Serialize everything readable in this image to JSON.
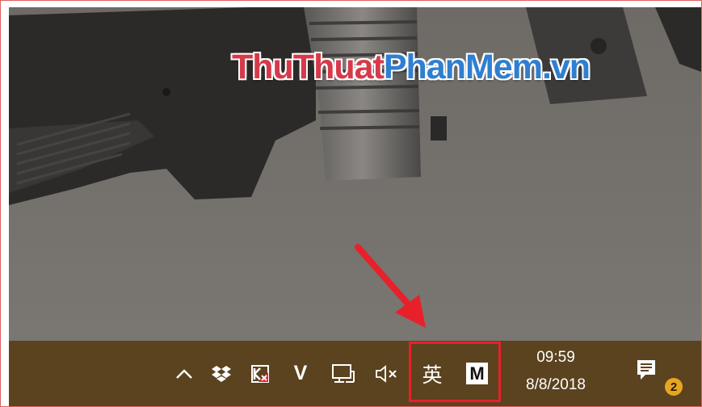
{
  "watermark": {
    "part1": "ThuThuat",
    "part2": "PhanMem.vn"
  },
  "taskbar": {
    "tray_icons": [
      {
        "name": "show-hidden-icons",
        "icon": "chevron-up-icon"
      },
      {
        "name": "dropbox",
        "icon": "dropbox-icon"
      },
      {
        "name": "kaspersky",
        "icon": "kaspersky-icon"
      },
      {
        "name": "vietkey",
        "label": "V",
        "icon": "v-icon"
      },
      {
        "name": "network",
        "icon": "network-icon"
      },
      {
        "name": "volume-muted",
        "icon": "speaker-muted-icon"
      }
    ],
    "ime": {
      "language": "英",
      "mode": "M"
    },
    "clock": {
      "time": "09:59",
      "date": "8/8/2018"
    },
    "notifications": {
      "count": "2",
      "icon": "action-center-icon"
    }
  },
  "colors": {
    "taskbar": "#5b431f",
    "highlight": "#e8202a",
    "arrow": "#e8202a",
    "badge": "#e8a520"
  }
}
